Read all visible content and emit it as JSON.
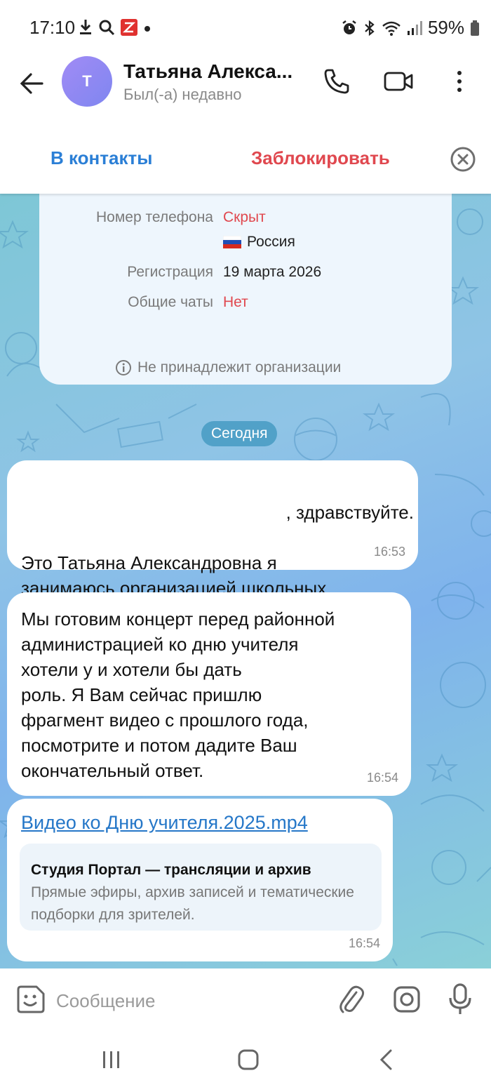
{
  "status_bar": {
    "time": "17:10",
    "battery": "59%",
    "left_icons": [
      "download-icon",
      "search-icon",
      "app-z-icon",
      "dot-icon"
    ],
    "right_icons": [
      "alarm-icon",
      "bluetooth-icon",
      "wifi-icon",
      "signal-icon",
      "battery-icon"
    ]
  },
  "header": {
    "avatar_letter": "Т",
    "name": "Татьяна Алекса...",
    "status": "Был(-а) недавно",
    "accent": "#8e89f3"
  },
  "actions": {
    "add_contact": "В контакты",
    "block": "Заблокировать",
    "add_contact_color": "#2b7fd6",
    "block_color": "#e0484f"
  },
  "info": {
    "phone_label": "Номер телефона",
    "phone_value": "Скрыт",
    "country": "Россия",
    "registration_label": "Регистрация",
    "registration_value": "19 марта 2026",
    "common_chats_label": "Общие чаты",
    "common_chats_value": "Нет",
    "org_note": "Не принадлежит организации"
  },
  "date_chip": "Сегодня",
  "messages": [
    {
      "line0": ", здравствуйте.",
      "text": "Это Татьяна Александровна я\nзанимаюсь организацией школьных\nмероприятий.",
      "time": "16:53"
    },
    {
      "text": "Мы готовим концерт перед районной\nадминистрацией ко дню учителя\nхотели у и хотели бы дать\nроль. Я Вам сейчас пришлю\nфрагмент видео с прошлого года,\nпосмотрите и потом дадите Ваш\nокончательный ответ.",
      "time": "16:54"
    },
    {
      "link": "Видео ко Дню учителя.2025.mp4",
      "preview_title": "Студия Портал — трансляции и архив",
      "preview_desc": "Прямые эфиры, архив записей и тематические подборки для зрителей.",
      "time": "16:54"
    }
  ],
  "input": {
    "placeholder": "Сообщение"
  }
}
